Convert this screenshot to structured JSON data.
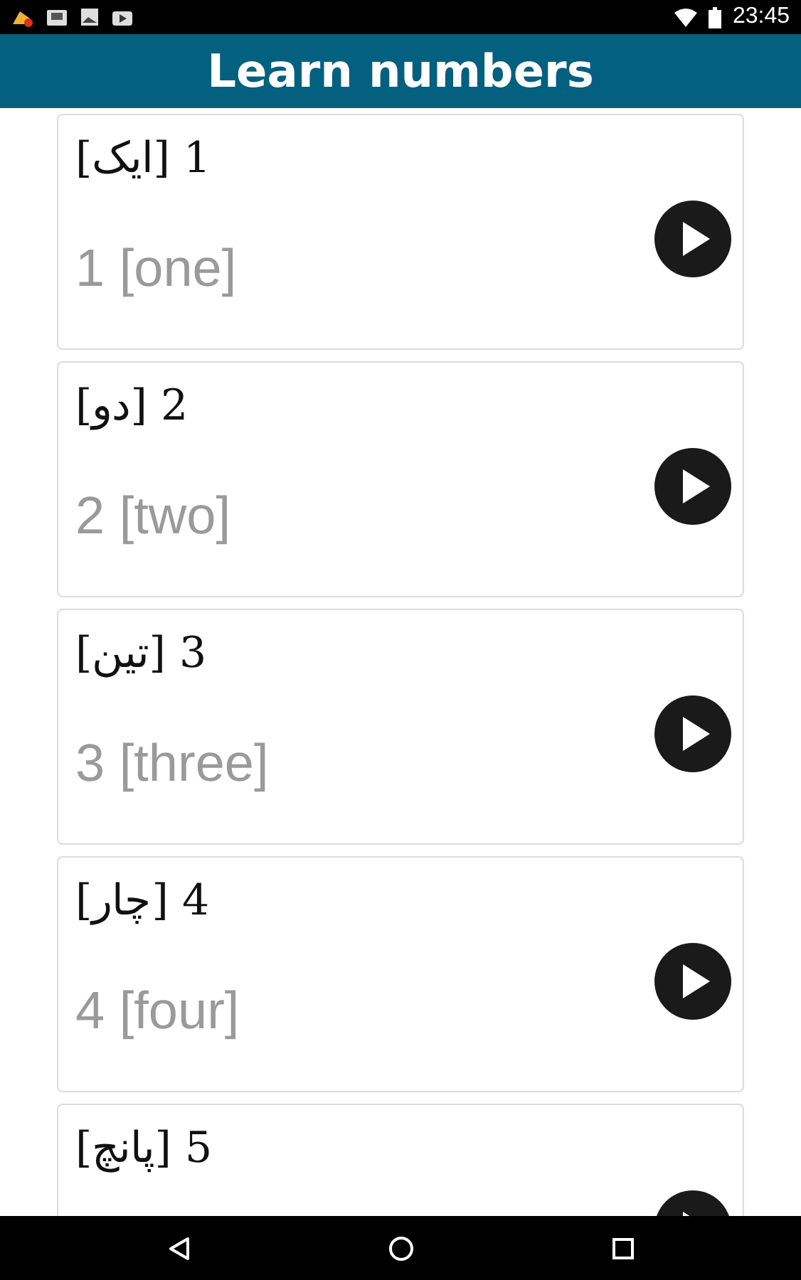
{
  "status_bar": {
    "time": "23:45"
  },
  "header": {
    "title": "Learn numbers"
  },
  "cards": [
    {
      "native": "1 [ایک]",
      "english": "1 [one]"
    },
    {
      "native": "2 [دو]",
      "english": "2 [two]"
    },
    {
      "native": "3 [تین]",
      "english": "3 [three]"
    },
    {
      "native": "4 [چار]",
      "english": "4 [four]"
    },
    {
      "native": "5 [پانچ]"
    }
  ]
}
